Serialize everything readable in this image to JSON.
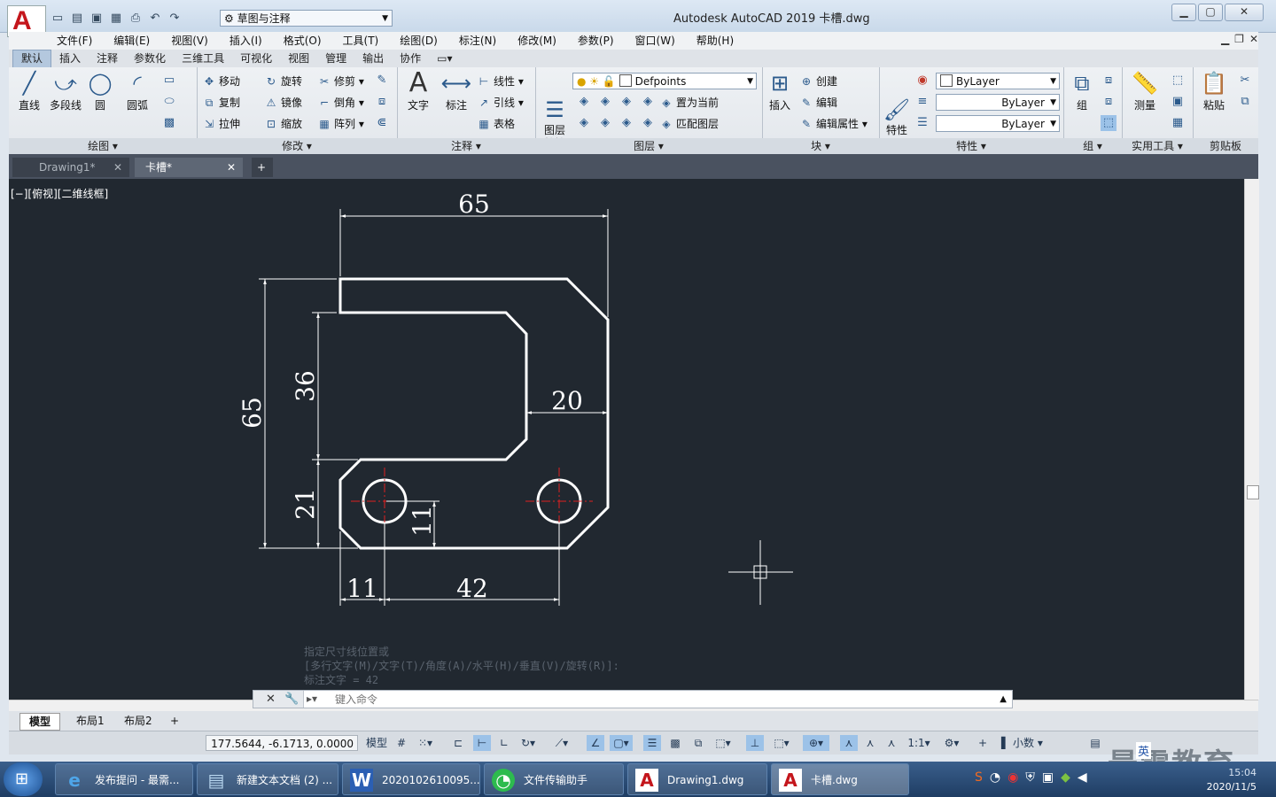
{
  "title_bar": {
    "app_logo": "A",
    "workspace": "草图与注释",
    "window_title": "Autodesk AutoCAD 2019    卡槽.dwg"
  },
  "menu": [
    "文件(F)",
    "编辑(E)",
    "视图(V)",
    "插入(I)",
    "格式(O)",
    "工具(T)",
    "绘图(D)",
    "标注(N)",
    "修改(M)",
    "参数(P)",
    "窗口(W)",
    "帮助(H)"
  ],
  "ribbon_tabs": [
    "默认",
    "插入",
    "注释",
    "参数化",
    "三维工具",
    "可视化",
    "视图",
    "管理",
    "输出",
    "协作"
  ],
  "ribbon": {
    "draw": {
      "title": "绘图",
      "line": "直线",
      "polyline": "多段线",
      "circle": "圆",
      "arc": "圆弧"
    },
    "modify": {
      "title": "修改",
      "move": "移动",
      "rotate": "旋转",
      "trim": "修剪",
      "copy": "复制",
      "mirror": "镜像",
      "fillet": "倒角",
      "stretch": "拉伸",
      "scale": "缩放",
      "array": "阵列"
    },
    "annotation": {
      "title": "注释",
      "text": "文字",
      "dimension": "标注",
      "linear": "线性",
      "leader": "引线",
      "table": "表格"
    },
    "layers": {
      "title": "图层",
      "props": "图层\n特性",
      "layer_name": "Defpoints",
      "set_current": "置为当前",
      "match_layer": "匹配图层"
    },
    "block": {
      "title": "块",
      "insert": "插入",
      "create": "创建",
      "edit": "编辑",
      "edit_attr": "编辑属性"
    },
    "properties": {
      "title": "特性",
      "match": "特性\n匹配",
      "color": "ByLayer",
      "linetype": "ByLayer",
      "lineweight": "ByLayer"
    },
    "groups": {
      "title": "组",
      "group": "组"
    },
    "utilities": {
      "title": "实用工具",
      "measure": "测量"
    },
    "clipboard": {
      "title": "剪贴板",
      "paste": "粘贴"
    }
  },
  "doc_tabs": [
    {
      "label": "Drawing1*",
      "active": false
    },
    {
      "label": "卡槽*",
      "active": true
    }
  ],
  "view_label": "[−][俯视][二维线框]",
  "dimensions": {
    "top_width": "65",
    "left_height": "65",
    "slot_height": "36",
    "right_wall": "20",
    "lower_height": "21",
    "hole_offset_y": "11",
    "hole_offset_x": "11",
    "hole_spacing": "42"
  },
  "command_history": [
    "指定尺寸线位置或",
    "[多行文字(M)/文字(T)/角度(A)/水平(H)/垂直(V)/旋转(R)]:",
    "标注文字 = 42"
  ],
  "command_placeholder": "键入命令",
  "layout_tabs": [
    "模型",
    "布局1",
    "布局2"
  ],
  "status": {
    "coords": "177.5644, -6.1713, 0.0000",
    "model": "模型",
    "scale": "1:1",
    "units": "小数"
  },
  "taskbar": [
    {
      "label": "发布提问 - 最需...",
      "icon": "ie-icon"
    },
    {
      "label": "新建文本文档 (2) ...",
      "icon": "notepad-icon"
    },
    {
      "label": "2020102610095...",
      "icon": "word-icon"
    },
    {
      "label": "文件传输助手",
      "icon": "wechat-icon"
    },
    {
      "label": "Drawing1.dwg",
      "icon": "autocad-icon"
    },
    {
      "label": "卡槽.dwg",
      "icon": "autocad-icon"
    }
  ],
  "tray": {
    "ime": "英",
    "date": "2020/11/5"
  },
  "watermark": "最需教育",
  "colors": {
    "canvas": "#212830",
    "geometry": "#ffffff",
    "center_line": "#e02020",
    "accent": "#c4161c"
  }
}
